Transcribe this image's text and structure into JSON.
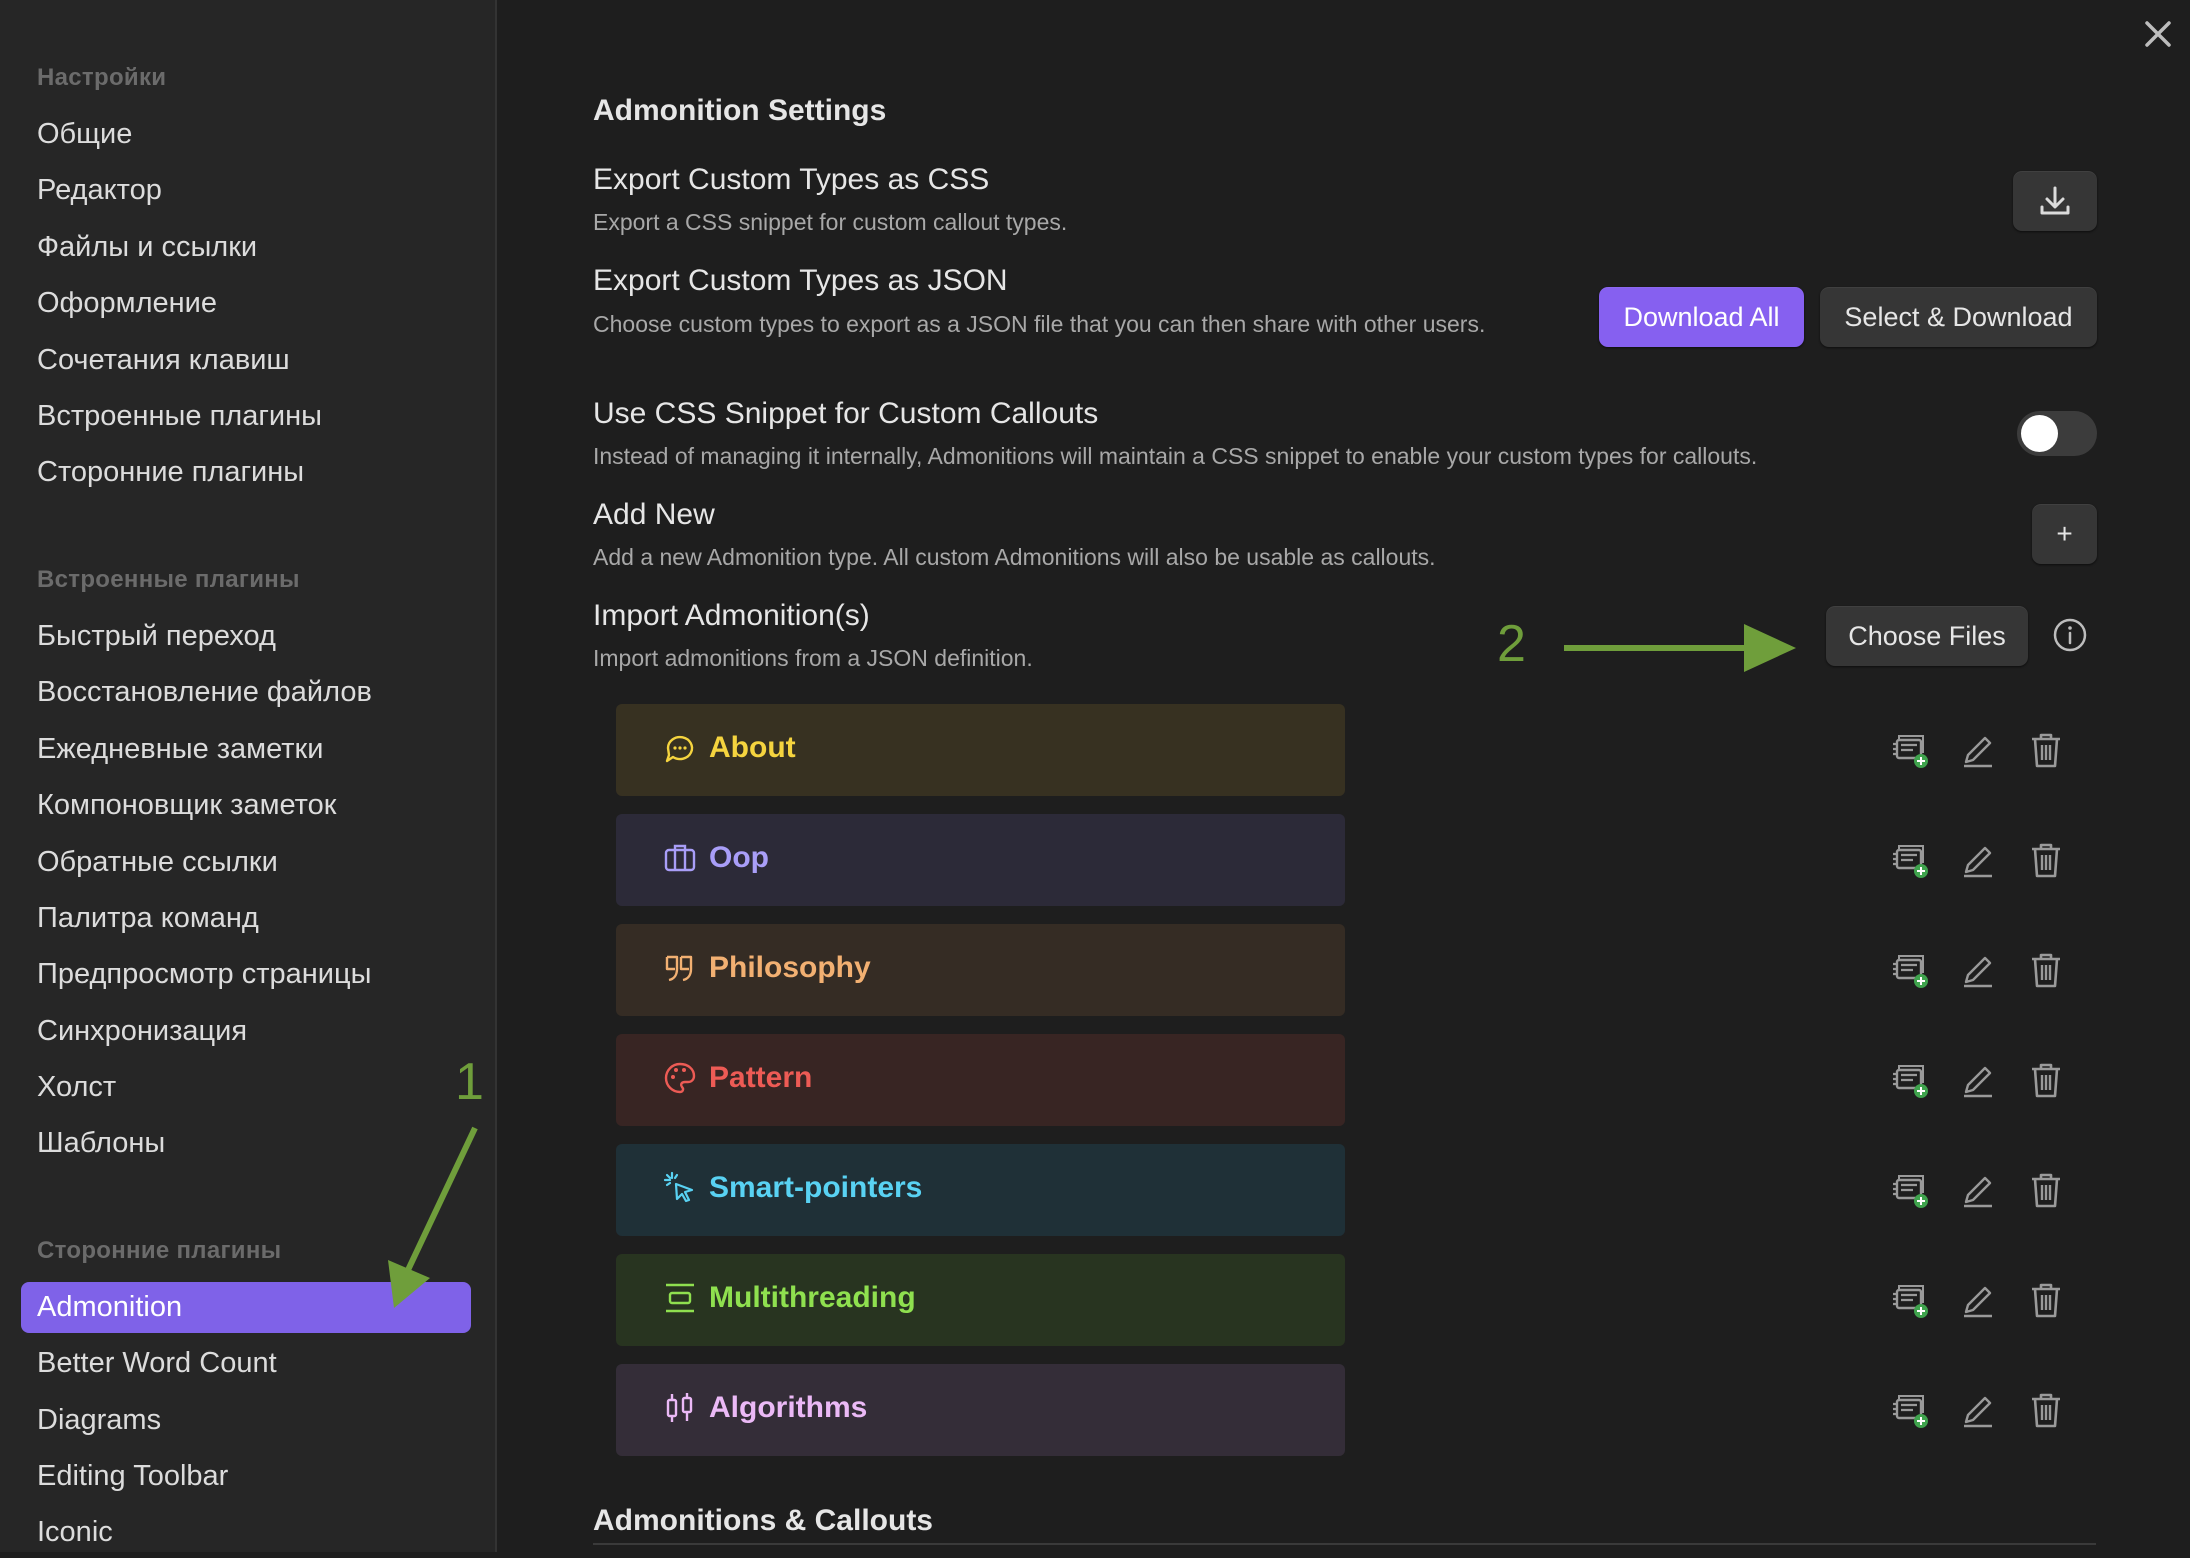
{
  "sidebar": {
    "section_core": "Настройки",
    "core_items": [
      "Общие",
      "Редактор",
      "Файлы и ссылки",
      "Оформление",
      "Сочетания клавиш",
      "Встроенные плагины",
      "Сторонние плагины"
    ],
    "section_builtin": "Встроенные плагины",
    "builtin_items": [
      "Быстрый переход",
      "Восстановление файлов",
      "Ежедневные заметки",
      "Компоновщик заметок",
      "Обратные ссылки",
      "Палитра команд",
      "Предпросмотр страницы",
      "Синхронизация",
      "Холст",
      "Шаблоны"
    ],
    "section_community": "Сторонние плагины",
    "community_items": [
      "Admonition",
      "Better Word Count",
      "Diagrams",
      "Editing Toolbar",
      "Iconic"
    ],
    "active_item": "Admonition"
  },
  "main": {
    "title": "Admonition Settings",
    "settings": {
      "export_css": {
        "name": "Export Custom Types as CSS",
        "desc": "Export a CSS snippet for custom callout types."
      },
      "export_json": {
        "name": "Export Custom Types as JSON",
        "desc": "Choose custom types to export as a JSON file that you can then share with other users.",
        "download_all": "Download All",
        "select_download": "Select & Download"
      },
      "css_snippet": {
        "name": "Use CSS Snippet for Custom Callouts",
        "desc": "Instead of managing it internally, Admonitions will maintain a CSS snippet to enable your custom types for callouts.",
        "enabled": false
      },
      "add_new": {
        "name": "Add New",
        "desc": "Add a new Admonition type. All custom Admonitions will also be usable as callouts.",
        "button": "+"
      },
      "import": {
        "name": "Import Admonition(s)",
        "desc": "Import admonitions from a JSON definition.",
        "button": "Choose Files"
      }
    },
    "admonitions": [
      {
        "label": "About",
        "icon": "speech-bubble-icon",
        "color": "#f5d43f",
        "bg": "#373121"
      },
      {
        "label": "Oop",
        "icon": "briefcase-icon",
        "color": "#a99ef8",
        "bg": "#2c2a38"
      },
      {
        "label": "Philosophy",
        "icon": "quote-icon",
        "color": "#f2b072",
        "bg": "#352c24"
      },
      {
        "label": "Pattern",
        "icon": "palette-icon",
        "color": "#ed5b55",
        "bg": "#382523"
      },
      {
        "label": "Smart-pointers",
        "icon": "pointer-click-icon",
        "color": "#59d2f3",
        "bg": "#1f3037"
      },
      {
        "label": "Multithreading",
        "icon": "align-center-icon",
        "color": "#8fe04f",
        "bg": "#283420"
      },
      {
        "label": "Algorithms",
        "icon": "candlestick-icon",
        "color": "#ebb9f6",
        "bg": "#342d38"
      }
    ],
    "footer_title": "Admonitions & Callouts"
  },
  "annotations": {
    "one": "1",
    "two": "2",
    "arrow_color": "#6f9e3b"
  }
}
